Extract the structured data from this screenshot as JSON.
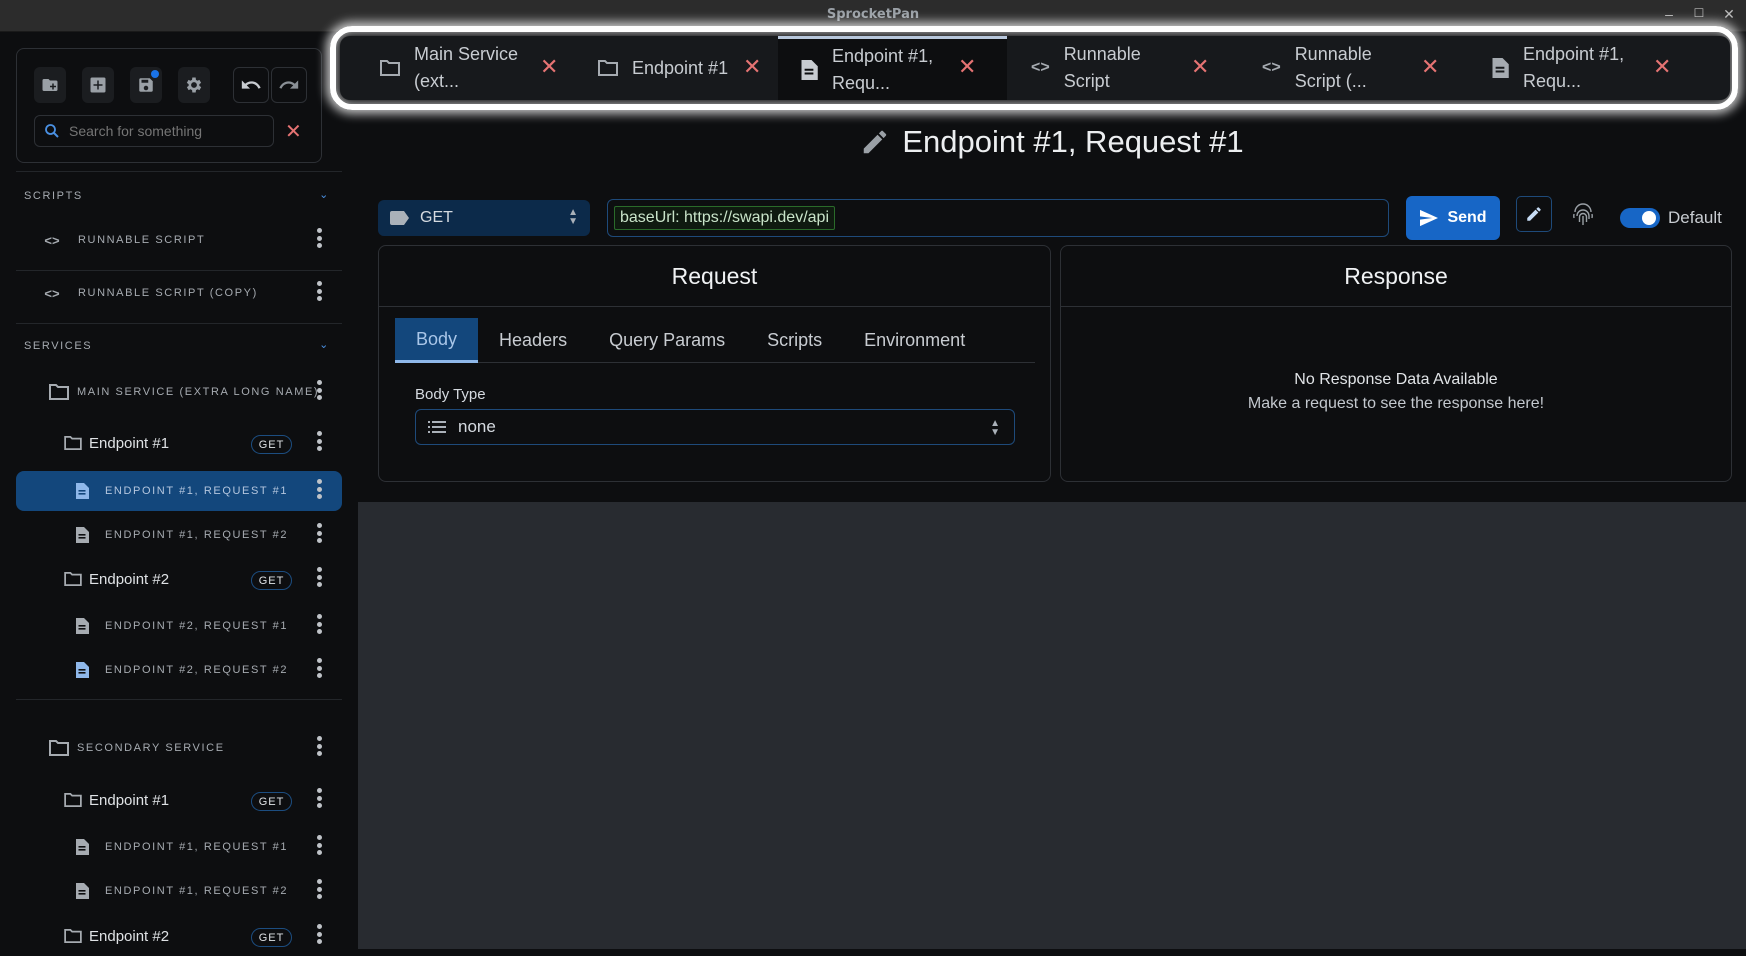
{
  "window": {
    "title": "SprocketPan",
    "controls": {
      "minimize": "–",
      "maximize": "☐",
      "close": "✕"
    }
  },
  "sidebar": {
    "toolbar": {
      "buttons": [
        {
          "name": "new-service",
          "icon": "folder-plus-icon"
        },
        {
          "name": "new-item",
          "icon": "plus-box-icon"
        },
        {
          "name": "save",
          "icon": "save-icon",
          "unsaved_indicator": true
        },
        {
          "name": "settings",
          "icon": "gear-icon"
        },
        {
          "name": "undo",
          "icon": "undo-icon"
        },
        {
          "name": "redo",
          "icon": "redo-icon"
        }
      ],
      "search": {
        "placeholder": "Search for something",
        "value": ""
      },
      "clear_icon": "✕"
    },
    "sections": {
      "scripts": {
        "label": "SCRIPTS",
        "chevron": "⌄"
      },
      "services": {
        "label": "SERVICES",
        "chevron": "⌄"
      }
    },
    "scripts": [
      {
        "label": "RUNNABLE SCRIPT"
      },
      {
        "label": "RUNNABLE SCRIPT (COPY)"
      }
    ],
    "services": [
      {
        "label": "MAIN SERVICE (EXTRA LONG NAME)",
        "endpoints": [
          {
            "label": "Endpoint #1",
            "method": "GET",
            "requests": [
              {
                "label": "ENDPOINT #1, REQUEST #1",
                "selected": true
              },
              {
                "label": "ENDPOINT #1, REQUEST #2",
                "selected": false
              }
            ]
          },
          {
            "label": "Endpoint #2",
            "method": "GET",
            "requests": [
              {
                "label": "ENDPOINT #2, REQUEST #1",
                "selected": false
              },
              {
                "label": "ENDPOINT #2, REQUEST #2",
                "selected": false
              }
            ]
          }
        ]
      },
      {
        "label": "SECONDARY SERVICE",
        "endpoints": [
          {
            "label": "Endpoint #1",
            "method": "GET",
            "requests": [
              {
                "label": "ENDPOINT #1, REQUEST #1",
                "selected": false
              },
              {
                "label": "ENDPOINT #1, REQUEST #2",
                "selected": false
              }
            ]
          },
          {
            "label": "Endpoint #2",
            "method": "GET",
            "requests": []
          }
        ]
      }
    ]
  },
  "tabs": [
    {
      "label": "Main Service\n(ext...",
      "icon": "folder-icon",
      "active": false
    },
    {
      "label": "Endpoint #1",
      "icon": "folder-icon",
      "active": false
    },
    {
      "label": "Endpoint #1,\nRequ...",
      "icon": "document-icon",
      "active": true
    },
    {
      "label": "Runnable\nScript",
      "icon": "code-icon",
      "active": false
    },
    {
      "label": "Runnable\nScript (...",
      "icon": "code-icon",
      "active": false
    },
    {
      "label": "Endpoint #1,\nRequ...",
      "icon": "document-icon",
      "active": false
    }
  ],
  "tab_close": "✕",
  "main": {
    "heading": "Endpoint #1, Request #1",
    "method": {
      "value": "GET",
      "arrows": "⌃⌄"
    },
    "url": {
      "chip": "baseUrl: https://swapi.dev/api",
      "value": ""
    },
    "send_label": "Send",
    "environment_toggle": {
      "label": "Default",
      "on": true
    },
    "request_panel": {
      "title": "Request",
      "tabs": [
        "Body",
        "Headers",
        "Query Params",
        "Scripts",
        "Environment"
      ],
      "active_tab": "Body",
      "body_type_label": "Body Type",
      "body_type_value": "none"
    },
    "response_panel": {
      "title": "Response",
      "empty_title": "No Response Data Available",
      "empty_subtitle": "Make a request to see the response here!"
    }
  },
  "colors": {
    "accent": "#1766c6",
    "selected_bg": "#13477c",
    "close_red": "#e57373",
    "chip_green": "#2a6b2a"
  }
}
